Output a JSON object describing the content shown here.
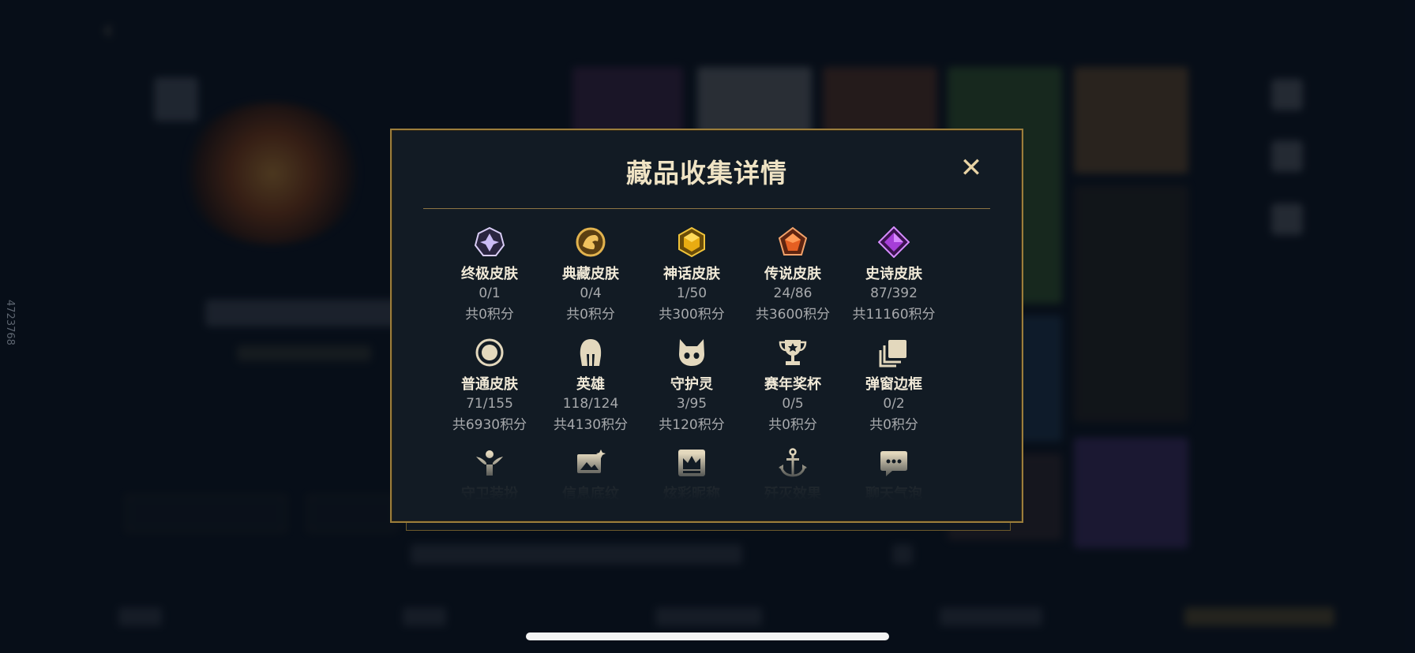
{
  "watermark": "4723768",
  "modal": {
    "title": "藏品收集详情",
    "close_symbol": "✕",
    "items": [
      {
        "label": "终极皮肤",
        "count": "0/1",
        "points": "共0积分",
        "icon": "ultimate-gem-icon",
        "color": "#b9a6e8"
      },
      {
        "label": "典藏皮肤",
        "count": "0/4",
        "points": "共0积分",
        "icon": "prestige-dragon-icon",
        "color": "#d6a73c"
      },
      {
        "label": "神话皮肤",
        "count": "1/50",
        "points": "共300积分",
        "icon": "mythic-gem-icon",
        "color": "#e7b21c"
      },
      {
        "label": "传说皮肤",
        "count": "24/86",
        "points": "共3600积分",
        "icon": "legendary-gem-icon",
        "color": "#e0642a"
      },
      {
        "label": "史诗皮肤",
        "count": "87/392",
        "points": "共11160积分",
        "icon": "epic-gem-icon",
        "color": "#a63ed8"
      },
      {
        "label": "普通皮肤",
        "count": "71/155",
        "points": "共6930积分",
        "icon": "standard-circle-icon",
        "color": "#e3d8bd"
      },
      {
        "label": "英雄",
        "count": "118/124",
        "points": "共4130积分",
        "icon": "champion-helmet-icon",
        "color": "#e3d8bd"
      },
      {
        "label": "守护灵",
        "count": "3/95",
        "points": "共120积分",
        "icon": "guardian-pet-icon",
        "color": "#e3d8bd"
      },
      {
        "label": "赛年奖杯",
        "count": "0/5",
        "points": "共0积分",
        "icon": "trophy-icon",
        "color": "#e3d8bd"
      },
      {
        "label": "弹窗边框",
        "count": "0/2",
        "points": "共0积分",
        "icon": "frame-stack-icon",
        "color": "#e3d8bd"
      }
    ],
    "more_items": [
      {
        "label": "守卫装扮",
        "icon": "ward-skin-icon"
      },
      {
        "label": "信息底纹",
        "icon": "info-card-icon"
      },
      {
        "label": "炫彩昵称",
        "icon": "crown-nameplate-icon"
      },
      {
        "label": "歼灭效果",
        "icon": "anchor-icon"
      },
      {
        "label": "聊天气泡",
        "icon": "chat-bubble-icon"
      }
    ]
  }
}
